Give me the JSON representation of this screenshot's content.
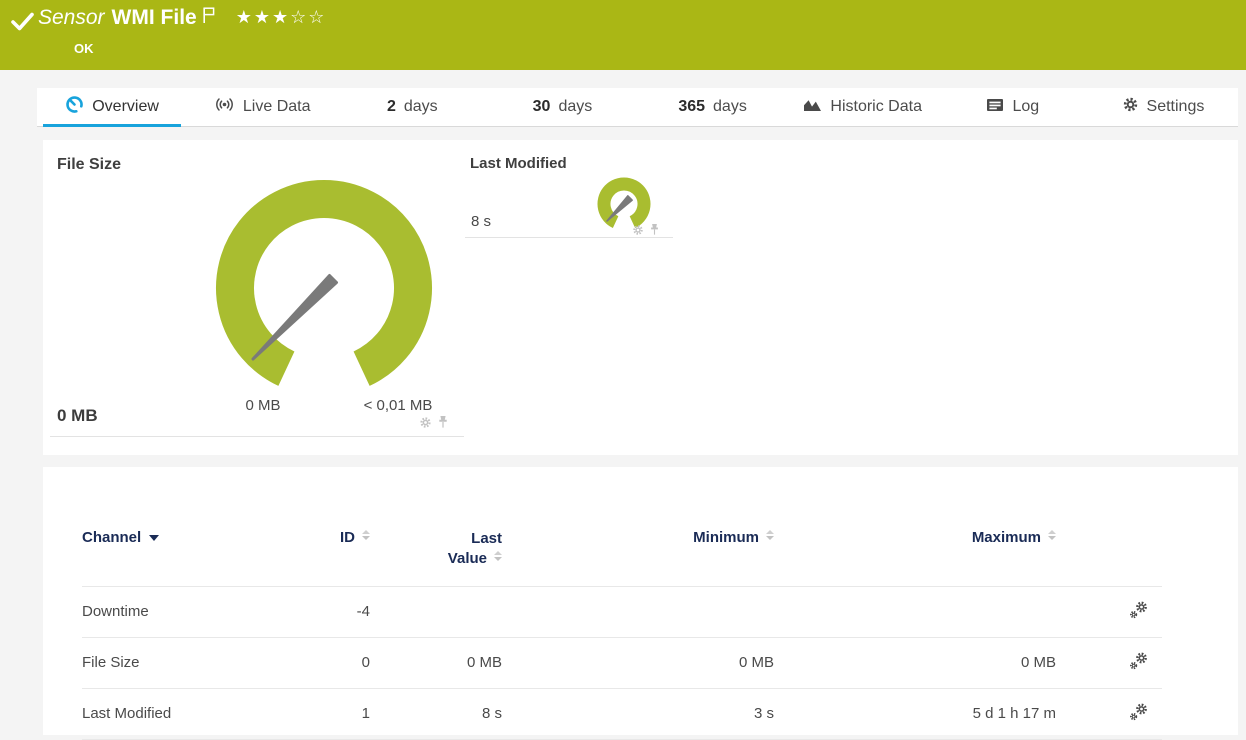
{
  "colors": {
    "header_green": "#aab715",
    "gauge_green": "#a9bd30",
    "accent_blue": "#18a3dc",
    "table_header_navy": "#1a2b56"
  },
  "header": {
    "sensor_label": "Sensor",
    "sensor_name": "WMI File",
    "status": "OK",
    "rating_filled": "★★★",
    "rating_empty": "☆☆"
  },
  "tabs": [
    {
      "label": "Overview",
      "icon": "gauge-icon",
      "active": true
    },
    {
      "label": "Live Data",
      "icon": "broadcast-icon"
    },
    {
      "num": "2",
      "label": "days"
    },
    {
      "num": "30",
      "label": "days"
    },
    {
      "num": "365",
      "label": "days"
    },
    {
      "label": "Historic Data",
      "icon": "area-chart-icon"
    },
    {
      "label": "Log",
      "icon": "log-icon"
    },
    {
      "label": "Settings",
      "icon": "gear-icon"
    }
  ],
  "gauges": {
    "file_size": {
      "title": "File Size",
      "value": "0 MB",
      "scale_min": "0 MB",
      "scale_max": "< 0,01 MB"
    },
    "last_modified": {
      "title": "Last Modified",
      "value": "8 s"
    }
  },
  "table": {
    "columns": [
      {
        "label": "Channel"
      },
      {
        "label": "ID"
      },
      {
        "label": "Last Value"
      },
      {
        "label": "Minimum"
      },
      {
        "label": "Maximum"
      }
    ],
    "rows": [
      {
        "channel": "Downtime",
        "id": "-4",
        "last_value": "",
        "minimum": "",
        "maximum": ""
      },
      {
        "channel": "File Size",
        "id": "0",
        "last_value": "0 MB",
        "minimum": "0 MB",
        "maximum": "0 MB"
      },
      {
        "channel": "Last Modified",
        "id": "1",
        "last_value": "8 s",
        "minimum": "3 s",
        "maximum": "5 d 1 h 17 m"
      }
    ]
  }
}
